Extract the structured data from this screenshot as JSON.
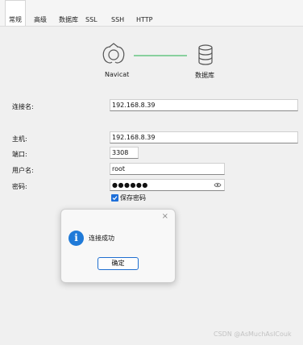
{
  "tabs": [
    {
      "label": "常规"
    },
    {
      "label": "高级"
    },
    {
      "label": "数据库"
    },
    {
      "label": "SSL"
    },
    {
      "label": "SSH"
    },
    {
      "label": "HTTP"
    }
  ],
  "graphic": {
    "left_label": "Navicat",
    "right_label": "数据库",
    "link_color": "#22b14c"
  },
  "form": {
    "connection_name_label": "连接名:",
    "connection_name_value": "192.168.8.39",
    "host_label": "主机:",
    "host_value": "192.168.8.39",
    "port_label": "端口:",
    "port_value": "3308",
    "username_label": "用户名:",
    "username_value": "root",
    "password_label": "密码:",
    "password_value": "●●●●●●",
    "save_password_label": "保存密码",
    "save_password_checked": true
  },
  "dialog": {
    "message": "连接成功",
    "ok_label": "确定",
    "close_glyph": "×",
    "icon_glyph": "i"
  },
  "watermark": "CSDN @AsMuchAsICouk",
  "colors": {
    "accent": "#1f7ad8",
    "link_line": "#22b14c"
  }
}
